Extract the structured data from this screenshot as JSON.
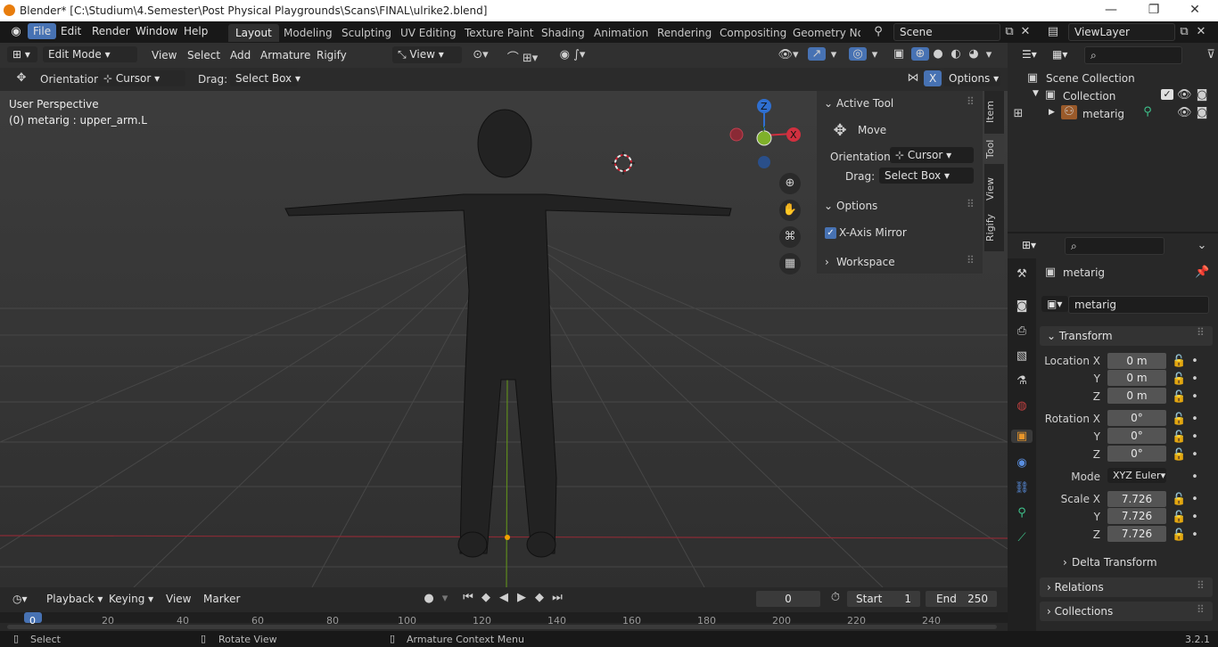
{
  "window": {
    "title": "Blender* [C:\\Studium\\4.Semester\\Post Physical Playgrounds\\Scans\\FINAL\\ulrike2.blend]",
    "min_icon": "minimize-icon",
    "max_icon": "maximize-icon",
    "close_icon": "close-icon"
  },
  "menus": [
    "File",
    "Edit",
    "Render",
    "Window",
    "Help"
  ],
  "workspaces": [
    "Layout",
    "Modeling",
    "Sculpting",
    "UV Editing",
    "Texture Paint",
    "Shading",
    "Animation",
    "Rendering",
    "Compositing",
    "Geometry Noc"
  ],
  "scene": "Scene",
  "view_layer": "ViewLayer",
  "header": {
    "mode": "Edit Mode",
    "menus": [
      "View",
      "Select",
      "Add",
      "Armature",
      "Rigify"
    ],
    "transform_orientation": "View"
  },
  "tool_header": {
    "orientation_label": "Orientation:",
    "orientation_value": "Cursor",
    "drag_label": "Drag:",
    "drag_value": "Select Box",
    "x_label": "X",
    "options": "Options"
  },
  "viewport": {
    "perspective": "User Perspective",
    "object_info": "(0) metarig : upper_arm.L",
    "gizmo": {
      "z": "Z",
      "y": "Y",
      "x": "X"
    }
  },
  "npanel": {
    "tabs": [
      "Item",
      "Tool",
      "View",
      "Rigify"
    ],
    "active_tool_title": "Active Tool",
    "tool_name": "Move",
    "orientation_label": "Orientation",
    "orientation_value": "Cursor",
    "drag_label": "Drag:",
    "drag_value": "Select Box",
    "options_title": "Options",
    "xmirror": "X-Axis Mirror",
    "xmirror_checked": true,
    "workspace_title": "Workspace"
  },
  "outliner": {
    "root": "Scene Collection",
    "collection": "Collection",
    "object": "metarig"
  },
  "properties": {
    "object_name": "metarig",
    "data_name": "metarig",
    "transform_title": "Transform",
    "location": {
      "label": "Location X",
      "x": "0 m",
      "y": "0 m",
      "z": "0 m"
    },
    "rotation": {
      "label": "Rotation X",
      "x": "0°",
      "y": "0°",
      "z": "0°"
    },
    "mode_label": "Mode",
    "mode_value": "XYZ Euler",
    "scale": {
      "label": "Scale X",
      "x": "7.726",
      "y": "7.726",
      "z": "7.726"
    },
    "axis_y": "Y",
    "axis_z": "Z",
    "delta": "Delta Transform",
    "relations": "Relations",
    "collections": "Collections"
  },
  "timeline": {
    "menus": [
      "Playback",
      "Keying",
      "View",
      "Marker"
    ],
    "current_frame": "0",
    "start_label": "Start",
    "start": "1",
    "end_label": "End",
    "end": "250",
    "ticks": [
      "0",
      "20",
      "40",
      "60",
      "80",
      "100",
      "120",
      "140",
      "160",
      "180",
      "200",
      "220",
      "240"
    ]
  },
  "status": {
    "select": "Select",
    "rotate": "Rotate View",
    "context": "Armature Context Menu",
    "version": "3.2.1"
  }
}
